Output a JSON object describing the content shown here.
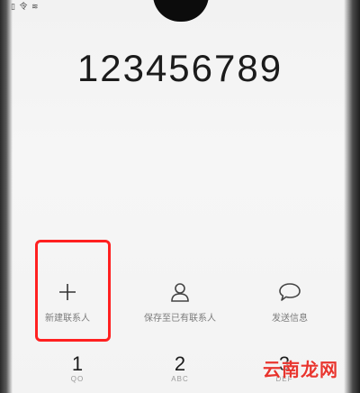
{
  "status_bar": {
    "left_text": "▯ 令 ≋"
  },
  "dialer": {
    "number": "123456789"
  },
  "actions": [
    {
      "label": "新建联系人",
      "icon": "plus-icon"
    },
    {
      "label": "保存至已有联系人",
      "icon": "person-icon"
    },
    {
      "label": "发送信息",
      "icon": "chat-bubble-icon"
    }
  ],
  "keypad": [
    {
      "digit": "1",
      "letters": "QO"
    },
    {
      "digit": "2",
      "letters": "ABC"
    },
    {
      "digit": "3",
      "letters": "DEF"
    }
  ],
  "watermark": "云南龙网",
  "colors": {
    "highlight": "#ff2020",
    "watermark": "#e8352e"
  }
}
